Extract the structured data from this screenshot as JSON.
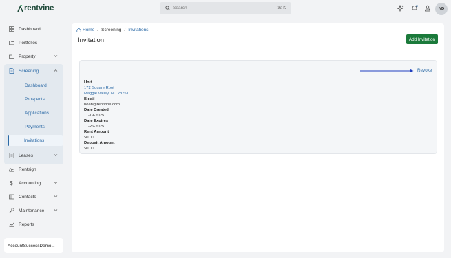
{
  "app": {
    "brand": "rentvine"
  },
  "search": {
    "placeholder": "Search",
    "shortcut": "⌘ K"
  },
  "user": {
    "initials": "ND"
  },
  "sidebar": {
    "items": [
      {
        "label": "Dashboard",
        "icon": "dashboard-icon"
      },
      {
        "label": "Portfolios",
        "icon": "folder-icon"
      },
      {
        "label": "Property",
        "icon": "building-icon"
      },
      {
        "label": "Screening",
        "icon": "document-icon"
      },
      {
        "label": "Leases",
        "icon": "lease-icon"
      },
      {
        "label": "Rentsign",
        "icon": "signature-icon"
      },
      {
        "label": "Accounting",
        "icon": "dollar-icon"
      },
      {
        "label": "Contacts",
        "icon": "contact-card-icon"
      },
      {
        "label": "Maintenance",
        "icon": "wrench-icon"
      },
      {
        "label": "Reports",
        "icon": "chart-icon"
      }
    ],
    "screening_sub": [
      {
        "label": "Dashboard"
      },
      {
        "label": "Prospects"
      },
      {
        "label": "Applications"
      },
      {
        "label": "Payments"
      },
      {
        "label": "Invitations"
      }
    ],
    "account": "AccountSuccessDemo..."
  },
  "breadcrumb": {
    "home": "Home",
    "section": "Screening",
    "current": "Invitations"
  },
  "page": {
    "title": "Invitation",
    "add_button": "Add Invitation"
  },
  "invitation": {
    "revoke": "Revoke",
    "unit_label": "Unit",
    "unit_line1": "172 Square Root",
    "unit_line2": "Maggie Valley, NC 28751",
    "email_label": "Email",
    "email": "noah@rentvine.com",
    "date_created_label": "Date Created",
    "date_created": "11-19-2025",
    "date_expires_label": "Date Expires",
    "date_expires": "11-26-2025",
    "rent_label": "Rent Amount",
    "rent": "$0.00",
    "deposit_label": "Deposit Amount",
    "deposit": "$0.00"
  },
  "colors": {
    "brand_green": "#1b7a3b",
    "link_blue": "#2c6aa6",
    "arrow_blue": "#1f3fbf"
  }
}
